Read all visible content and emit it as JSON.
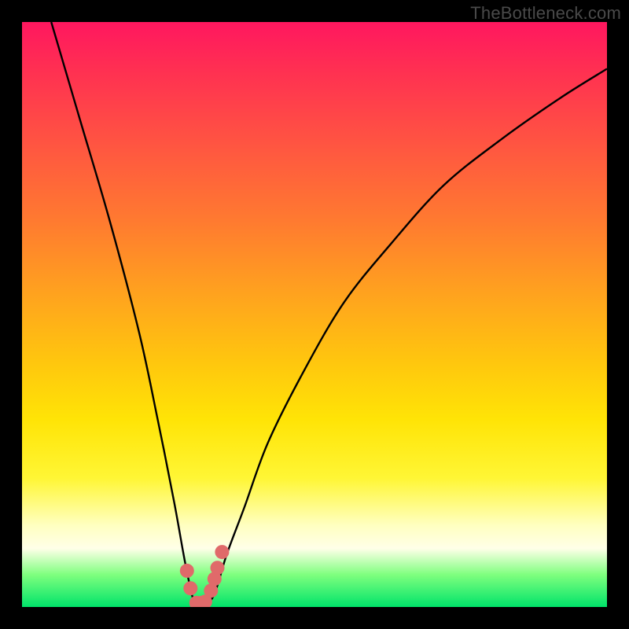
{
  "watermark": "TheBottleneck.com",
  "chart_data": {
    "type": "line",
    "title": "",
    "xlabel": "",
    "ylabel": "",
    "xlim": [
      0,
      100
    ],
    "ylim": [
      0,
      100
    ],
    "series": [
      {
        "name": "bottleneck-curve",
        "x": [
          5,
          10,
          15,
          20,
          23,
          26,
          28,
          29.6,
          31.5,
          33,
          35,
          38,
          42,
          48,
          55,
          63,
          72,
          82,
          92,
          100
        ],
        "y": [
          100,
          83,
          66,
          47,
          33,
          18,
          7,
          0.5,
          0.5,
          2.5,
          9,
          17,
          28,
          40,
          52,
          62,
          72,
          80,
          87,
          92
        ]
      }
    ],
    "markers": {
      "name": "highlight-points",
      "color": "#e06a6a",
      "x": [
        28.2,
        28.8,
        29.8,
        30.6,
        31.3,
        32.3,
        32.9,
        33.4,
        34.2
      ],
      "y": [
        6.2,
        3.2,
        0.7,
        0.7,
        0.9,
        2.8,
        4.8,
        6.7,
        9.4
      ]
    },
    "background": {
      "type": "vertical-gradient",
      "stops": [
        {
          "pos": 0.0,
          "color": "#ff175f"
        },
        {
          "pos": 0.22,
          "color": "#ff5840"
        },
        {
          "pos": 0.46,
          "color": "#ffa11f"
        },
        {
          "pos": 0.68,
          "color": "#ffe406"
        },
        {
          "pos": 0.86,
          "color": "#ffffc0"
        },
        {
          "pos": 0.945,
          "color": "#7eff7e"
        },
        {
          "pos": 1.0,
          "color": "#00e36a"
        }
      ]
    }
  }
}
